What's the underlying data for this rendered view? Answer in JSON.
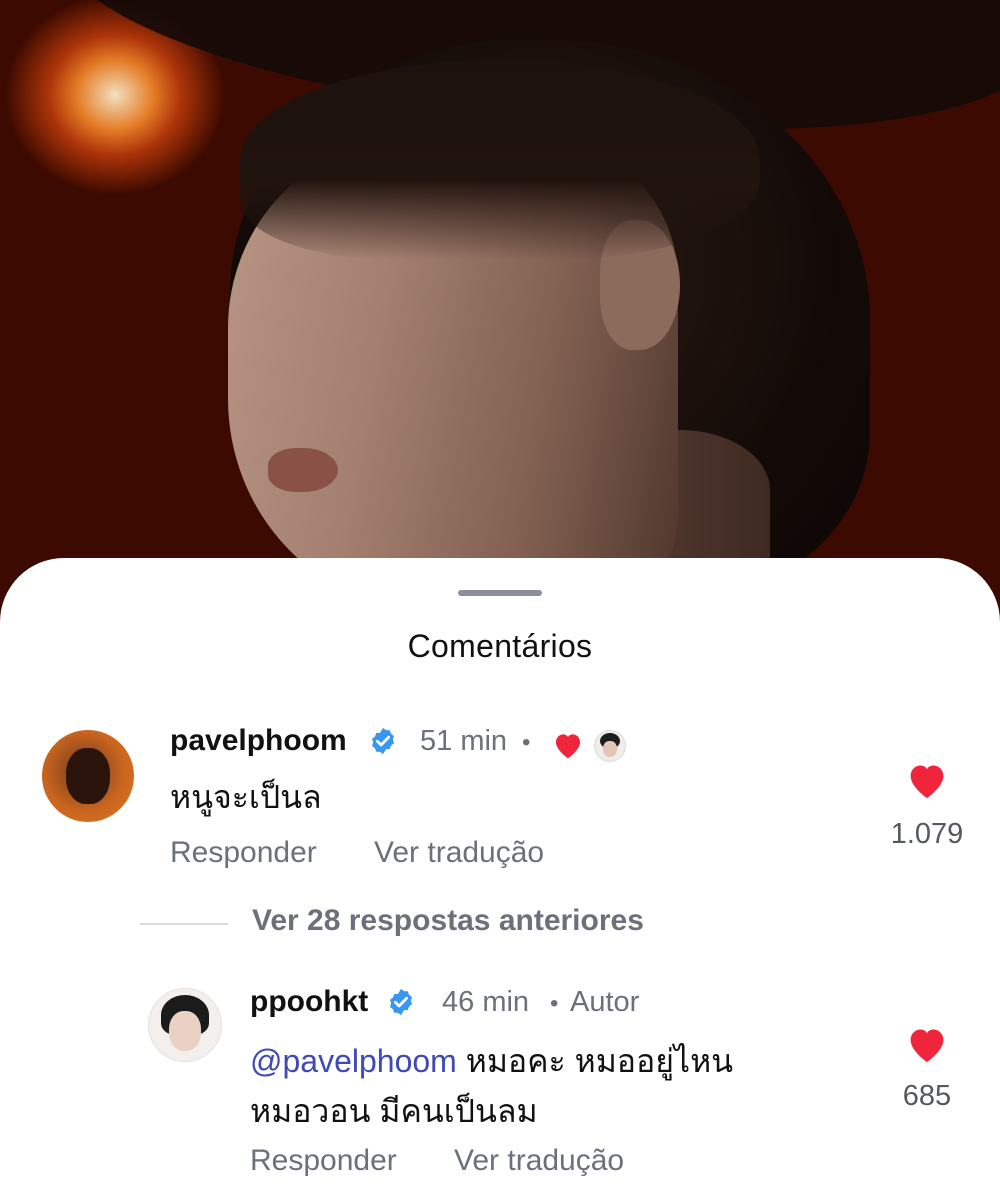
{
  "sheet": {
    "title": "Comentários"
  },
  "comments": [
    {
      "username": "pavelphoom",
      "verified": true,
      "time": "51 min",
      "separator": "•",
      "text": "หนูจะเป็นล",
      "reply_label": "Responder",
      "translate_label": "Ver tradução",
      "likes": "1.079",
      "liked_by_author": true
    },
    {
      "username": "ppoohkt",
      "verified": true,
      "time": "46 min",
      "separator": "•",
      "badge": "Autor",
      "mention": "@pavelphoom",
      "text_line1": "หมอคะ หมออยู่ไหน",
      "text_line2": "หมอวอน มีคนเป็นลม",
      "reply_label": "Responder",
      "translate_label": "Ver tradução",
      "likes": "685"
    }
  ],
  "replies": {
    "view_label": "Ver 28 respostas anteriores"
  },
  "colors": {
    "like": "#f0243b",
    "verified": "#3897f0",
    "mention": "#3f49b8",
    "secondary_text": "#6c707a"
  },
  "icons": [
    "verified-badge-icon",
    "heart-icon",
    "author-liked-avatar"
  ]
}
